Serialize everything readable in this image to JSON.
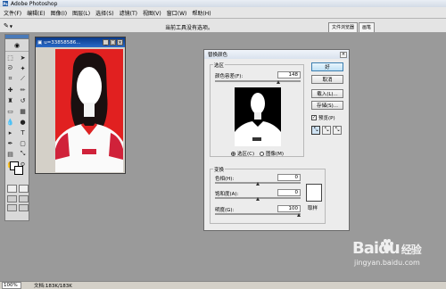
{
  "app": {
    "title": "Adobe Photoshop"
  },
  "menu": [
    "文件(F)",
    "编辑(E)",
    "图像(I)",
    "图层(L)",
    "选择(S)",
    "滤镜(T)",
    "视图(V)",
    "窗口(W)",
    "帮助(H)"
  ],
  "options_bar": {
    "hint": "当前工具没有选项。",
    "tabs": [
      "文件浏览器",
      "画笔"
    ]
  },
  "document": {
    "title": "u=33858586..."
  },
  "dialog": {
    "title": "替换颜色",
    "selection_group": "选区",
    "fuzziness_label": "颜色容差(F):",
    "fuzziness_value": "148",
    "fuzziness_level": 0.74,
    "radio_selection": "选区(C)",
    "radio_image": "图像(M)",
    "transform_group": "变换",
    "hue_label": "色相(H):",
    "hue_value": "0",
    "hue_level": 0.5,
    "saturation_label": "饱和度(A):",
    "saturation_value": "0",
    "saturation_level": 0.5,
    "lightness_label": "明度(G):",
    "lightness_value": "100",
    "lightness_level": 1.0,
    "sample_label": "取样",
    "buttons": {
      "ok": "好",
      "cancel": "取消",
      "load": "载入(L)...",
      "save": "存储(S)..."
    },
    "preview_label": "预览(P)",
    "preview_checked": true
  },
  "status": {
    "zoom": "100%",
    "doc": "文档:183K/183K"
  },
  "watermark": {
    "brand": "Baidu",
    "suffix": "经验",
    "site": "jingyan.baidu.com"
  },
  "colors": {
    "red_bg": "#e12020",
    "accent": "#1f5aa6"
  }
}
